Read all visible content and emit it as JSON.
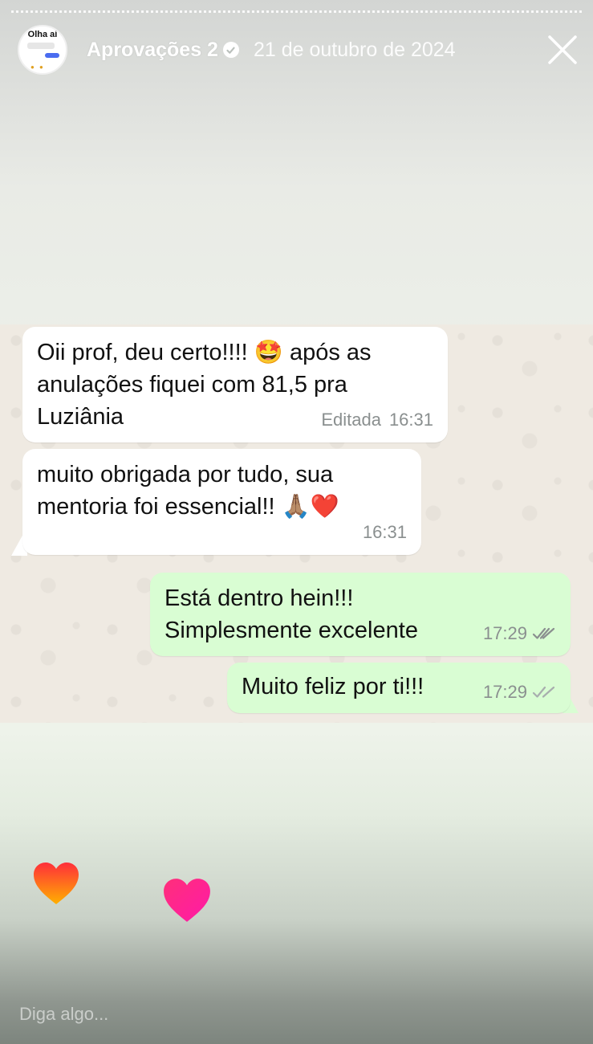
{
  "story": {
    "author": "Aprovações 2",
    "date": "21 de outubro de 2024",
    "avatar_text": "Olha aí"
  },
  "icons": {
    "verified": "verified-badge-icon",
    "close": "close-icon",
    "read": "double-check-icon",
    "reaction": "heart-icon"
  },
  "colors": {
    "incoming_bubble": "#ffffff",
    "outgoing_bubble": "#d9fdd3",
    "chat_bg": "#efeae2",
    "tick_grey": "#8a8f8f"
  },
  "messages": [
    {
      "direction": "incoming",
      "lines": [
        "Oii prof, deu certo!!!! 🤩 após as",
        "anulações fiquei com 81,5 pra",
        "Luziânia"
      ],
      "edited_label": "Editada",
      "time": "16:31"
    },
    {
      "direction": "incoming",
      "lines": [
        "muito obrigada por tudo, sua",
        "mentoria foi essencial!! 🙏🏽❤️"
      ],
      "time": "16:31"
    },
    {
      "direction": "outgoing",
      "lines": [
        "Está dentro hein!!!",
        "Simplesmente excelente"
      ],
      "time": "17:29"
    },
    {
      "direction": "outgoing",
      "lines": [
        "Muito feliz por ti!!!"
      ],
      "time": "17:29"
    }
  ],
  "reply": {
    "placeholder": "Diga algo..."
  }
}
